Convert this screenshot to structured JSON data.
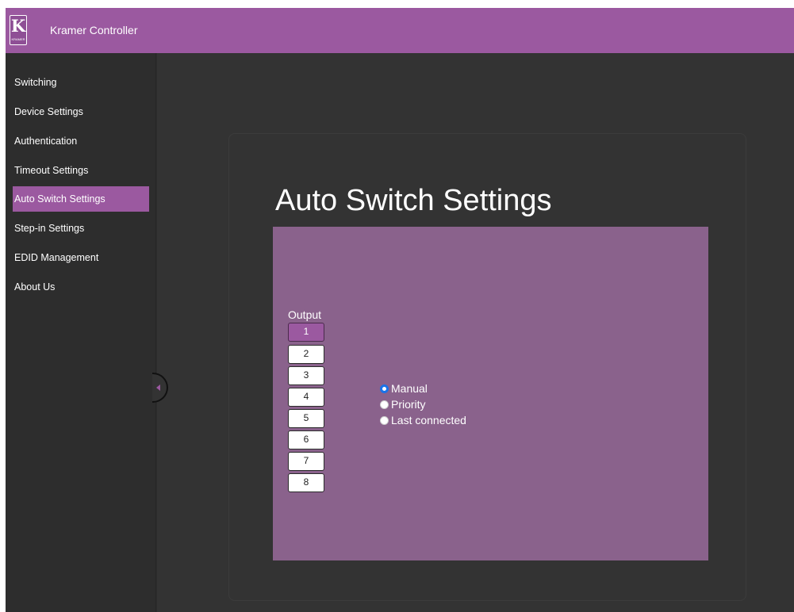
{
  "app": {
    "title": "Kramer Controller",
    "logo_letter": "K",
    "logo_word": "KRAMER"
  },
  "sidebar": {
    "items": [
      {
        "label": "Switching"
      },
      {
        "label": "Device Settings"
      },
      {
        "label": "Authentication"
      },
      {
        "label": "Timeout Settings"
      },
      {
        "label": "Auto Switch Settings",
        "active": true
      },
      {
        "label": "Step-in Settings"
      },
      {
        "label": "EDID Management"
      },
      {
        "label": "About Us"
      }
    ]
  },
  "main": {
    "page_title": "Auto Switch Settings",
    "output_label": "Output",
    "outputs": [
      "1",
      "2",
      "3",
      "4",
      "5",
      "6",
      "7",
      "8"
    ],
    "selected_output": "1",
    "modes": [
      {
        "label": "Manual",
        "checked": true
      },
      {
        "label": "Priority",
        "checked": false
      },
      {
        "label": "Last connected",
        "checked": false
      }
    ]
  },
  "colors": {
    "accent": "#9b59a0",
    "panel": "#8a628c",
    "background": "#333333"
  }
}
